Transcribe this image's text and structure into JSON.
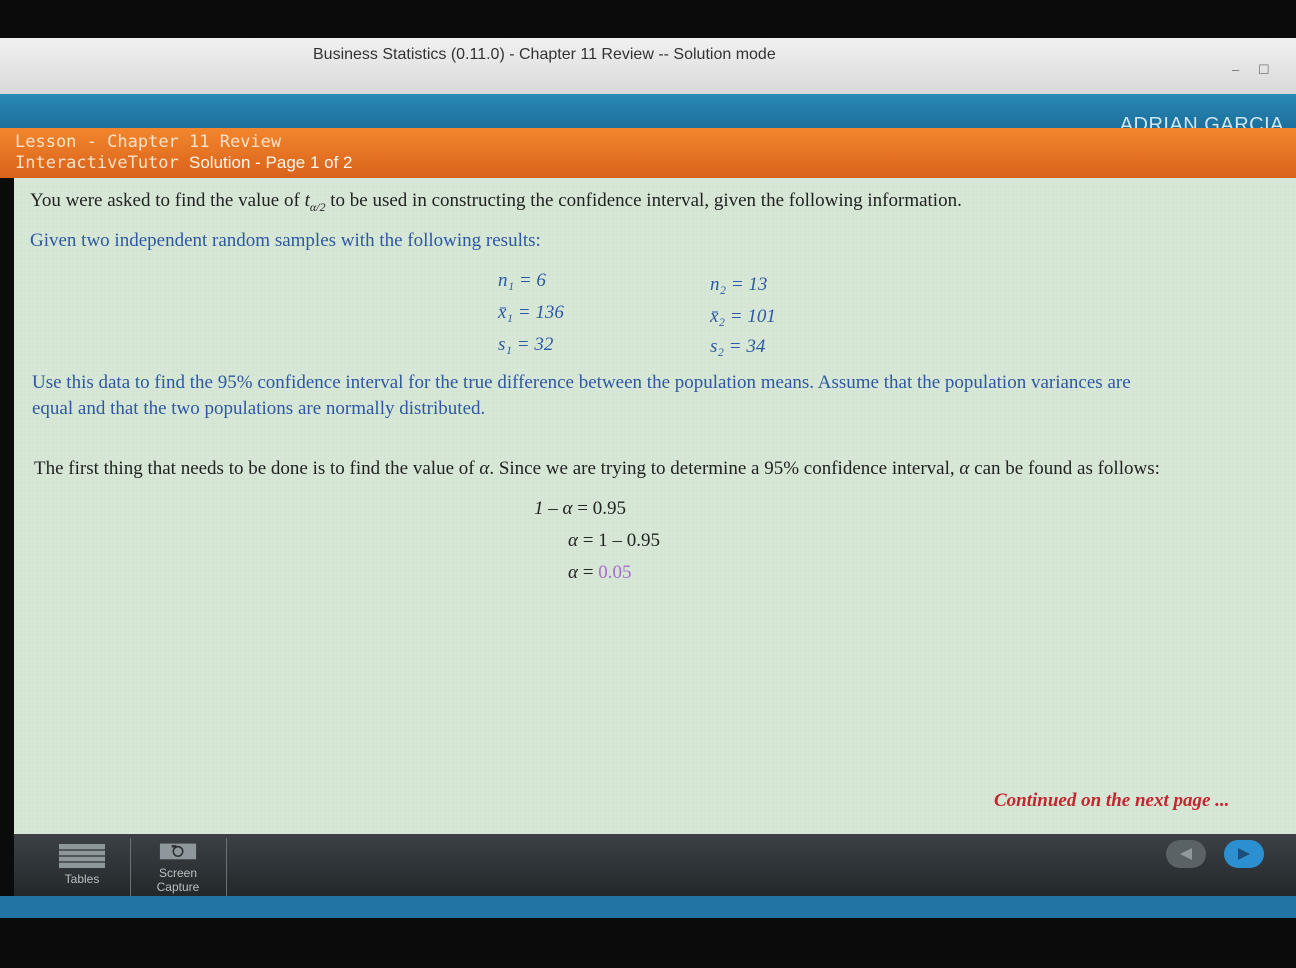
{
  "window": {
    "title": "Business Statistics (0.11.0) - Chapter 11 Review -- Solution mode",
    "minimize_label": "–",
    "maximize_label": "☐"
  },
  "header": {
    "user_name": "ADRIAN GARCIA"
  },
  "lesson": {
    "line1_prefix": "Lesson",
    "line1_chapter": "- Chapter 11 Review",
    "line2_brand": "InteractiveTutor",
    "line2_page": "Solution - Page 1 of 2"
  },
  "problem": {
    "intro_a": "You were asked to find the value of ",
    "t_symbol": "t",
    "t_subscript": "α/2",
    "intro_b": " to be used in constructing the confidence interval, given the following information.",
    "given": "Given two independent random samples with the following results:",
    "sample1": {
      "n": "n₁ = 6",
      "xbar": "x̄₁ = 136",
      "s": "s₁ = 32"
    },
    "sample2": {
      "n": "n₂ = 13",
      "xbar": "x̄₂ = 101",
      "s": "s₂ = 34"
    },
    "task_line1": "Use this data to find the 95% confidence interval for the true difference between the population means.  Assume that the population variances are",
    "task_line2": "equal and that the two populations are normally distributed."
  },
  "solution": {
    "step_a": "The first thing that needs to be done is to find the value of ",
    "alpha": "α",
    "step_b": ".  Since we are trying to determine a 95% confidence interval, ",
    "step_c": " can be found as follows:",
    "eq1_lhs": "1 – α",
    "eq1_rhs": "= 0.95",
    "eq2_lhs": "α",
    "eq2_rhs": "= 1 – 0.95",
    "eq3_lhs": "α",
    "eq3_eq": "=",
    "eq3_result": "0.05"
  },
  "continued": "Continued on the next page ...",
  "toolbar": {
    "tables_label": "Tables",
    "screen_line1": "Screen",
    "screen_line2": "Capture"
  },
  "colors": {
    "accent_orange": "#e8721f",
    "header_blue": "#2174a3",
    "text_blue": "#2d58a3",
    "continued_red": "#c2262e"
  }
}
